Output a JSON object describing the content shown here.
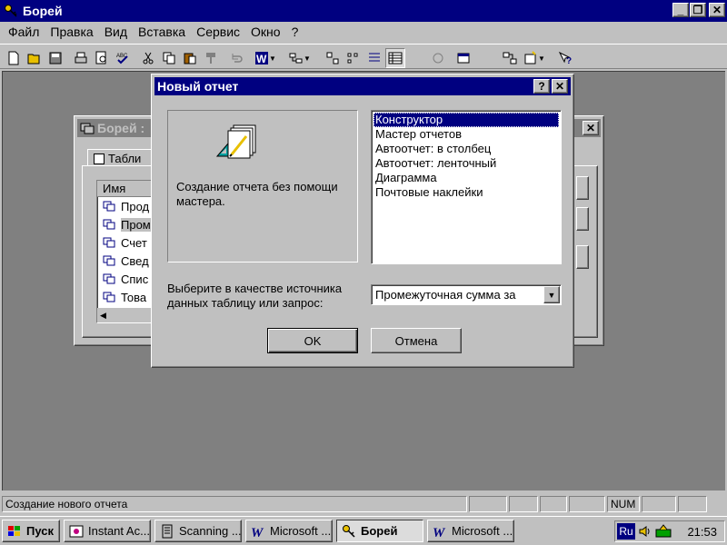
{
  "app": {
    "title": "Борей",
    "icon": "key-icon"
  },
  "menu": [
    {
      "label": "Файл"
    },
    {
      "label": "Правка"
    },
    {
      "label": "Вид"
    },
    {
      "label": "Вставка"
    },
    {
      "label": "Сервис"
    },
    {
      "label": "Окно"
    },
    {
      "label": "?"
    }
  ],
  "db_window": {
    "title": "Борей :",
    "tab_label": "Табли",
    "list_header": "Имя",
    "items": [
      "Прод",
      "Пром",
      "Счет",
      "Свед",
      "Спис",
      "Това"
    ]
  },
  "dialog": {
    "title": "Новый отчет",
    "help_label": "?",
    "close_label": "✕",
    "preview_text": "Создание отчета без помощи мастера.",
    "options": [
      "Конструктор",
      "Мастер отчетов",
      "Автоотчет:  в столбец",
      "Автоотчет:  ленточный",
      "Диаграмма",
      "Почтовые наклейки"
    ],
    "selected_option": "Конструктор",
    "source_label": "Выберите в качестве источника данных таблицу или запрос:",
    "source_value": "Промежуточная сумма за",
    "ok_label": "OK",
    "cancel_label": "Отмена"
  },
  "status": {
    "text": "Создание нового отчета",
    "num": "NUM"
  },
  "taskbar": {
    "start_label": "Пуск",
    "tasks": [
      {
        "label": "Instant Ac...",
        "icon": "camera-icon"
      },
      {
        "label": "Scanning ...",
        "icon": "scanner-icon"
      },
      {
        "label": "Microsoft ...",
        "icon": "word-icon"
      },
      {
        "label": "Борей",
        "icon": "key-icon"
      },
      {
        "label": "Microsoft ...",
        "icon": "word-icon"
      }
    ],
    "language": "Ru",
    "clock": "21:53"
  },
  "colors": {
    "title_active": "#000080",
    "title_inactive": "#808080",
    "face": "#c0c0c0",
    "workspace": "#808080"
  }
}
